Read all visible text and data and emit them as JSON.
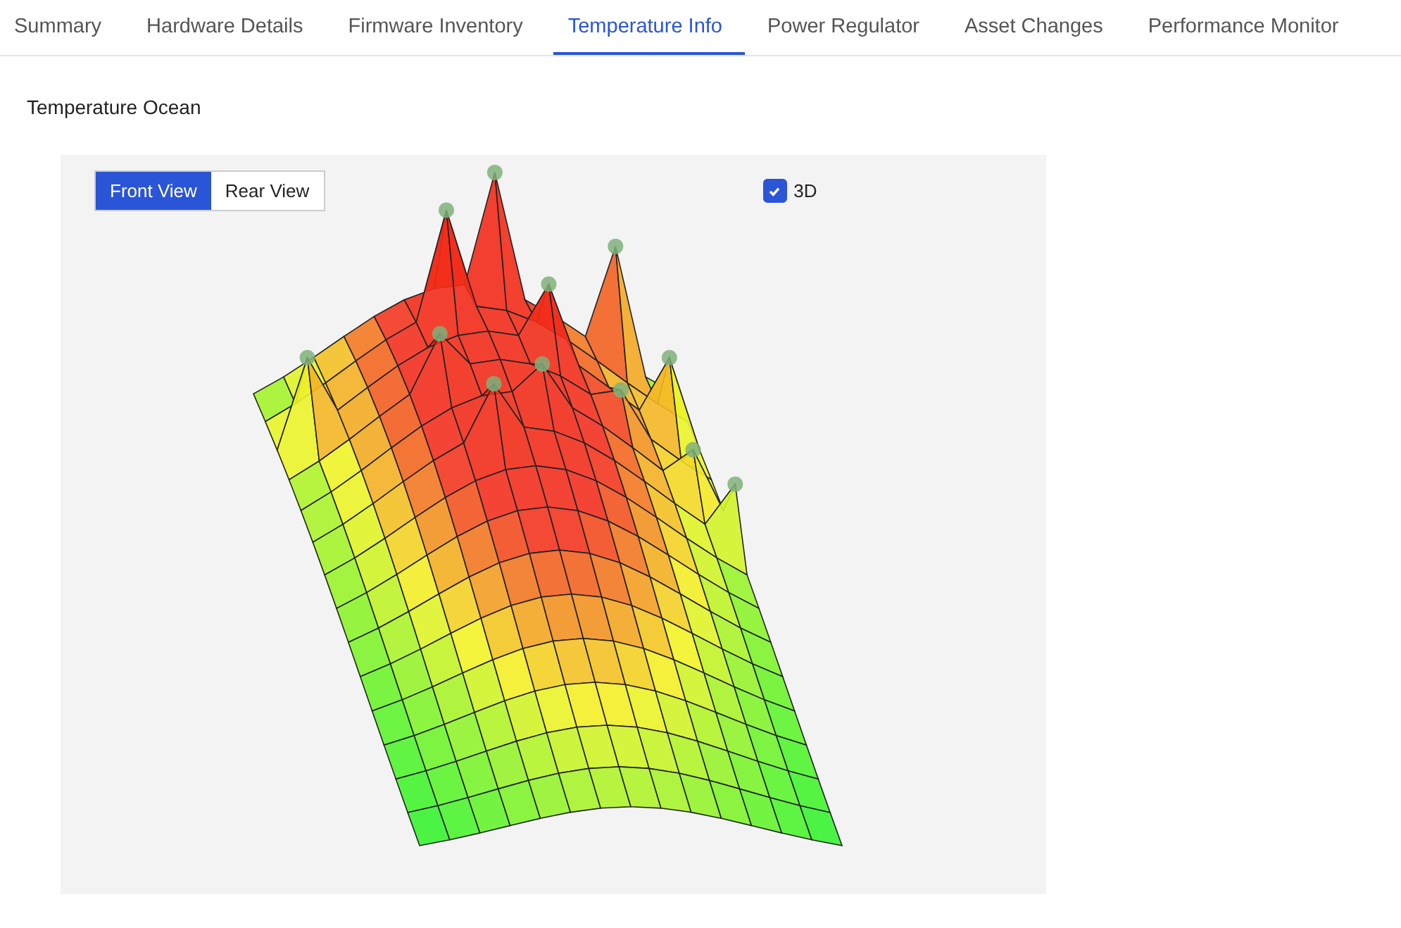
{
  "tabs": [
    {
      "label": "Summary",
      "selected": false
    },
    {
      "label": "Hardware Details",
      "selected": false
    },
    {
      "label": "Firmware Inventory",
      "selected": false
    },
    {
      "label": "Temperature Info",
      "selected": true
    },
    {
      "label": "Power Regulator",
      "selected": false
    },
    {
      "label": "Asset Changes",
      "selected": false
    },
    {
      "label": "Performance Monitor",
      "selected": false
    }
  ],
  "section_title": "Temperature Ocean",
  "view_buttons": [
    {
      "label": "Front View",
      "selected": true
    },
    {
      "label": "Rear View",
      "selected": false
    }
  ],
  "option_3d": {
    "label": "3D",
    "checked": true
  }
}
